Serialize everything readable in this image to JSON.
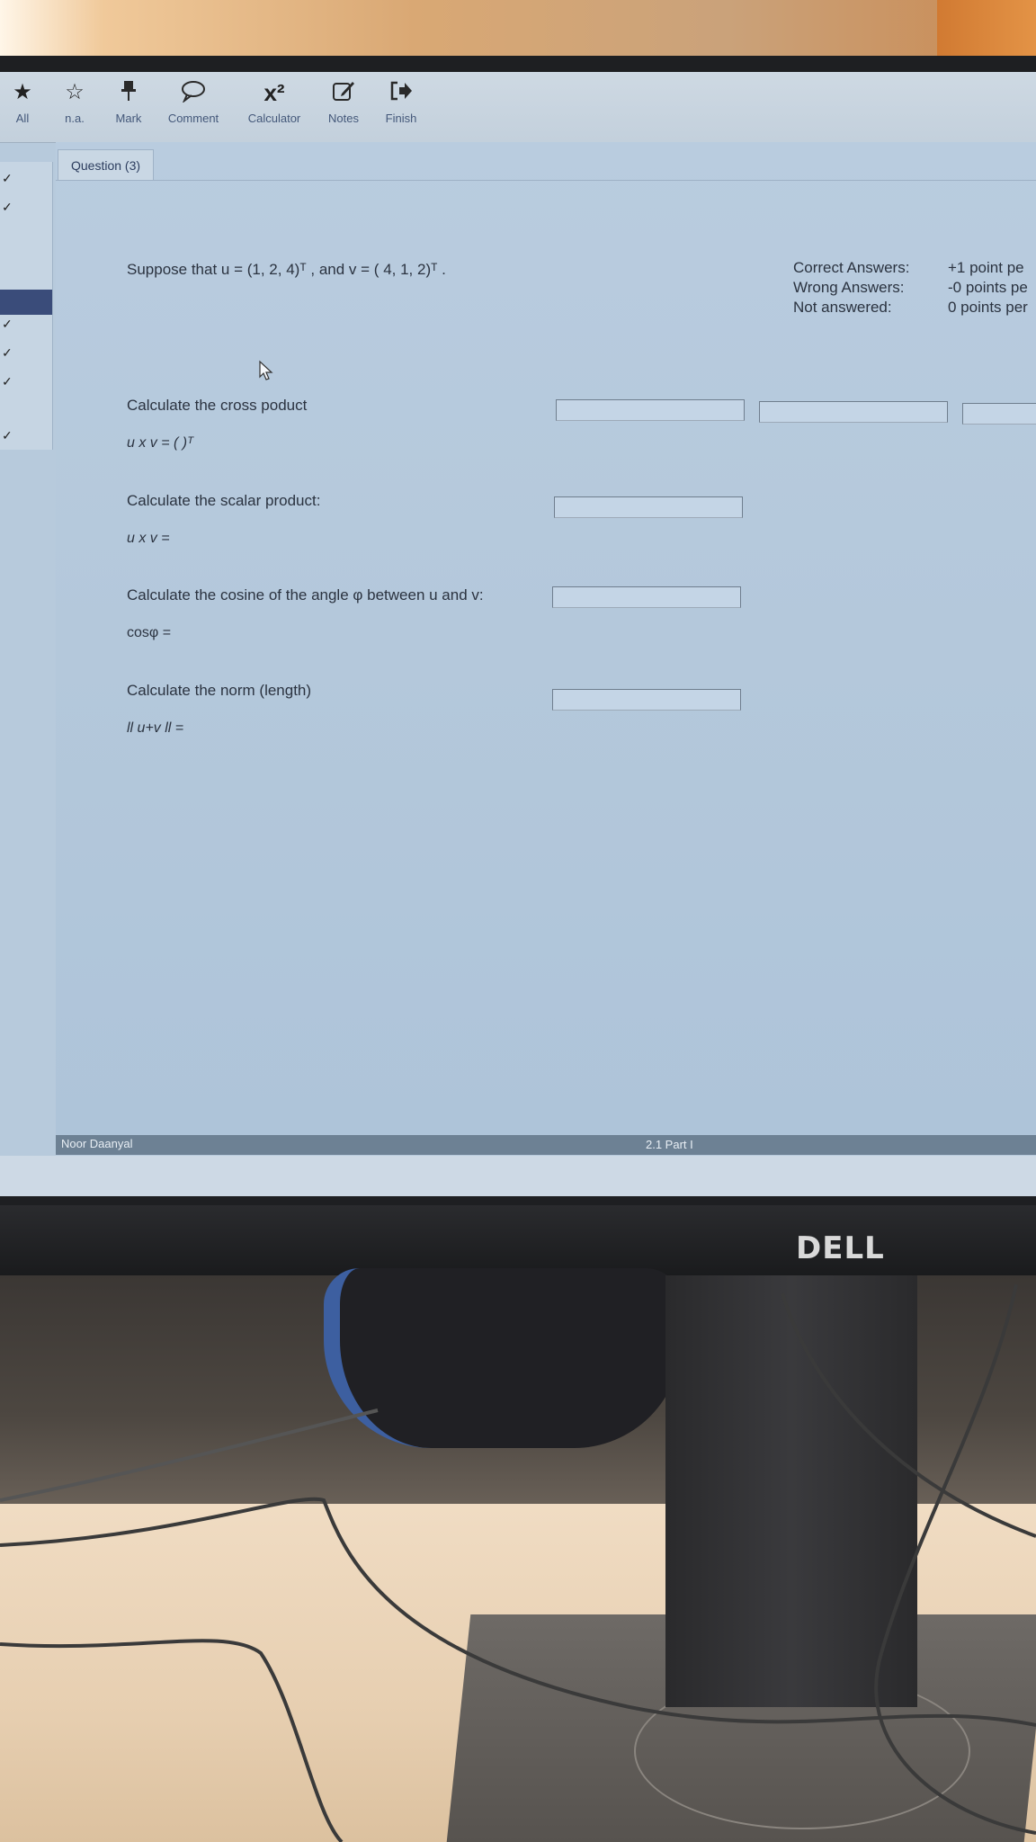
{
  "toolbar": {
    "items": [
      {
        "label": "All",
        "icon": "star-filled-icon"
      },
      {
        "label": "n.a.",
        "icon": "star-outline-icon"
      },
      {
        "label": "Mark",
        "icon": "pin-icon"
      },
      {
        "label": "Comment",
        "icon": "speech-bubble-icon"
      },
      {
        "label": "Calculator",
        "icon": "x-squared-icon",
        "glyph": "x²"
      },
      {
        "label": "Notes",
        "icon": "edit-note-icon"
      },
      {
        "label": "Finish",
        "icon": "exit-arrow-icon"
      }
    ]
  },
  "question": {
    "tab_label": "Question (3)",
    "intro": "Suppose that u = (1, 2, 4)ᵀ , and v = ( 4, 1, 2)ᵀ .",
    "parts": [
      {
        "prompt": "Calculate the cross poduct",
        "expression": "u x v = (          )ᵀ"
      },
      {
        "prompt": "Calculate the scalar product:",
        "expression": "u x v ="
      },
      {
        "prompt": "Calculate the cosine of the angle φ between u and v:",
        "expression": "cosφ ="
      },
      {
        "prompt": "Calculate the norm (length)",
        "expression": "ll u+v ll ="
      }
    ]
  },
  "scoring": [
    {
      "label": "Correct Answers:",
      "value": "+1 point pe"
    },
    {
      "label": "Wrong Answers:",
      "value": "-0 points pe"
    },
    {
      "label": "Not answered:",
      "value": "0 points per"
    }
  ],
  "statusbar": {
    "user": "Noor Daanyal",
    "part": "2.1 Part I"
  },
  "monitor": {
    "brand": "DELL"
  },
  "colors": {
    "screen_bg": "#b7cadc",
    "toolbar_bg": "#c9d5e0",
    "statusbar_bg": "#6d8194",
    "sidebar_active": "#3a4c7a"
  }
}
